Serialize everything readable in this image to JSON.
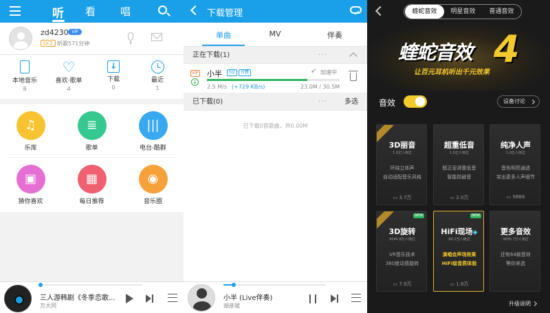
{
  "home": {
    "tabs": [
      "听",
      "看",
      "唱"
    ],
    "user": {
      "name": "zd4230",
      "vip_badge": "VIP",
      "level": "LV.1",
      "listen_time": "听歌571分钟"
    },
    "quick": [
      {
        "label": "本地音乐",
        "count": "8",
        "icon": "phone-icon"
      },
      {
        "label": "喜欢·歌单",
        "count": "4",
        "icon": "heart-icon"
      },
      {
        "label": "下载",
        "count": "0",
        "icon": "download-icon"
      },
      {
        "label": "最近",
        "count": "1",
        "icon": "clock-icon"
      }
    ],
    "grid": [
      {
        "label": "乐库",
        "color": "#f7c331",
        "icon": "music-note-icon"
      },
      {
        "label": "歌单",
        "color": "#35c98f",
        "icon": "playlist-icon"
      },
      {
        "label": "电台·酷群",
        "color": "#38a8f0",
        "icon": "radio-wave-icon"
      },
      {
        "label": "猜你喜欢",
        "color": "#e56fd5",
        "icon": "radio-icon"
      },
      {
        "label": "每日推荐",
        "color": "#f06070",
        "icon": "calendar-icon"
      },
      {
        "label": "音乐圈",
        "color": "#f6a13a",
        "icon": "music-circle-icon"
      }
    ],
    "player": {
      "title": "三人游韩剧《冬季恋歌...",
      "artist": "方大同",
      "progress": 0.0
    }
  },
  "downloads": {
    "title": "下载管理",
    "tabs": [
      "单曲",
      "MV",
      "伴奏"
    ],
    "downloading_header": "正在下载(1)",
    "downloaded_header": "已下载(0)",
    "more_dots": "···",
    "multi_select": "多选",
    "item": {
      "vip": "VIP",
      "status_icon": "↓",
      "name": "小半",
      "sq": "SQ",
      "pay": "付费",
      "status": "加速中",
      "speed": "2.5 M/s",
      "boost": "(+729 KB/s)",
      "size": "23.0M / 30.5M",
      "progress": 0.754
    },
    "empty_note": "已下载0首歌曲，共0.00M",
    "player": {
      "title": "小半 (Live伴奏)",
      "artist": "胡彦斌",
      "progress": 0.1
    }
  },
  "effects": {
    "tabs": [
      "蝰蛇音效",
      "明星音效",
      "普通音效"
    ],
    "hero_title": "蝰蛇音效",
    "hero_num": "4",
    "hero_sub": "让百元耳机听出千元效果",
    "fx_label": "音效",
    "device_btn": "设备讨论",
    "cards": [
      {
        "title": "3D丽音",
        "sub": "1.0亿人用过",
        "lines": [
          "环绕立体声",
          "自动适配音乐风格"
        ],
        "count": "3.7万",
        "ribbon": true,
        "new": false
      },
      {
        "title": "超重低音",
        "sub": "1.0亿人用过",
        "lines": [
          "醇正澎湃重低音",
          "智能防破音"
        ],
        "count": "2.0万",
        "ribbon": false,
        "new": false
      },
      {
        "title": "纯净人声",
        "sub": "1.0亿人用过",
        "lines": [
          "音色明亮通透",
          "突出更多人声细节"
        ],
        "count": "9888",
        "ribbon": false,
        "new": false
      },
      {
        "title": "3D旋转",
        "sub": "4244.8万人用过",
        "lines": [
          "VR音乐技术",
          "360度动感旋转"
        ],
        "count": "7.9万",
        "ribbon": true,
        "new": true
      },
      {
        "title": "HiFi现场",
        "sub": "88.1万人用过",
        "lines": [
          "演唱会声场效果",
          "HiFi级音质体验"
        ],
        "count": "1.8万",
        "ribbon": false,
        "new": true
      },
      {
        "title": "更多音效",
        "sub": "3656.7万人用过",
        "lines": [
          "还有64款音效",
          "等你来选"
        ],
        "count": "",
        "ribbon": false,
        "new": false
      }
    ],
    "upgrade": "升级说明"
  }
}
